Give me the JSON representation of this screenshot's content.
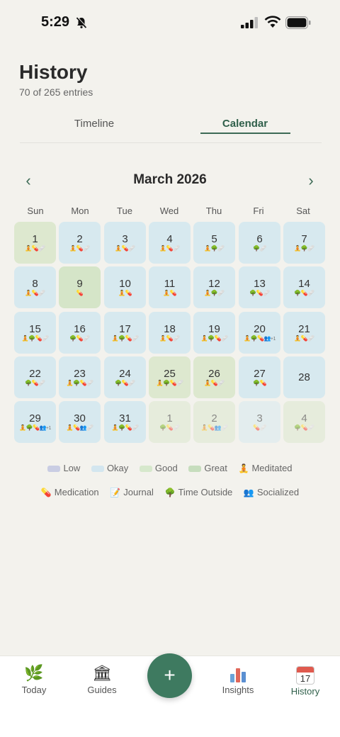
{
  "status_bar": {
    "time": "5:29",
    "icons": [
      "bell-slash-icon",
      "signal-icon",
      "wifi-icon",
      "battery-icon"
    ]
  },
  "header": {
    "title": "History",
    "subtitle": "70 of 265 entries"
  },
  "tabs": [
    {
      "label": "Timeline",
      "active": false
    },
    {
      "label": "Calendar",
      "active": true
    }
  ],
  "calendar": {
    "month_label": "March 2026",
    "prev_label": "‹",
    "next_label": "›",
    "weekdays": [
      "Sun",
      "Mon",
      "Tue",
      "Wed",
      "Thu",
      "Fri",
      "Sat"
    ],
    "days": [
      {
        "num": "1",
        "mood": "good",
        "emojis": "🧘💊🩹"
      },
      {
        "num": "2",
        "mood": "okay",
        "emojis": "🧘💊🩹"
      },
      {
        "num": "3",
        "mood": "okay",
        "emojis": "🧘💊🩹"
      },
      {
        "num": "4",
        "mood": "okay",
        "emojis": "🧘💊🩹"
      },
      {
        "num": "5",
        "mood": "okay",
        "emojis": "🧘🌳🩹"
      },
      {
        "num": "6",
        "mood": "okay",
        "emojis": "🌳🩹"
      },
      {
        "num": "7",
        "mood": "okay",
        "emojis": "🧘🌳🩹"
      },
      {
        "num": "8",
        "mood": "okay",
        "emojis": "🧘💊🩹"
      },
      {
        "num": "9",
        "mood": "great",
        "emojis": "💊"
      },
      {
        "num": "10",
        "mood": "okay",
        "emojis": "🧘💊"
      },
      {
        "num": "11",
        "mood": "okay",
        "emojis": "🧘💊"
      },
      {
        "num": "12",
        "mood": "okay",
        "emojis": "🧘🌳🩹"
      },
      {
        "num": "13",
        "mood": "okay",
        "emojis": "🌳💊🩹"
      },
      {
        "num": "14",
        "mood": "okay",
        "emojis": "🌳💊🩹"
      },
      {
        "num": "15",
        "mood": "okay",
        "emojis": "🧘🌳💊🩹"
      },
      {
        "num": "16",
        "mood": "okay",
        "emojis": "🌳💊🩹"
      },
      {
        "num": "17",
        "mood": "okay",
        "emojis": "🧘🌳💊🩹"
      },
      {
        "num": "18",
        "mood": "okay",
        "emojis": "🧘💊🩹"
      },
      {
        "num": "19",
        "mood": "okay",
        "emojis": "🧘🌳💊🩹"
      },
      {
        "num": "20",
        "mood": "okay",
        "emojis": "🧘🌳💊👥",
        "more": "+1"
      },
      {
        "num": "21",
        "mood": "okay",
        "emojis": "🧘💊🩹"
      },
      {
        "num": "22",
        "mood": "okay",
        "emojis": "🌳💊🩹"
      },
      {
        "num": "23",
        "mood": "okay",
        "emojis": "🧘🌳💊🩹"
      },
      {
        "num": "24",
        "mood": "okay",
        "emojis": "🌳💊🩹"
      },
      {
        "num": "25",
        "mood": "good",
        "emojis": "🧘🌳💊🩹"
      },
      {
        "num": "26",
        "mood": "good",
        "emojis": "🧘💊🩹"
      },
      {
        "num": "27",
        "mood": "okay",
        "emojis": "🌳💊"
      },
      {
        "num": "28",
        "mood": "okay",
        "emojis": ""
      },
      {
        "num": "29",
        "mood": "okay",
        "emojis": "🧘🌳💊👥",
        "more": "+1"
      },
      {
        "num": "30",
        "mood": "okay",
        "emojis": "🧘💊👥🩹"
      },
      {
        "num": "31",
        "mood": "okay",
        "emojis": "🧘🌳💊🩹"
      },
      {
        "num": "1",
        "mood": "good",
        "emojis": "🌳💊🩹",
        "outside": true
      },
      {
        "num": "2",
        "mood": "good",
        "emojis": "🧘💊👥🩹",
        "outside": true
      },
      {
        "num": "3",
        "mood": "okay",
        "emojis": "💊🩹",
        "outside": true
      },
      {
        "num": "4",
        "mood": "good",
        "emojis": "🌳💊🩹",
        "outside": true
      }
    ]
  },
  "legend": {
    "moods": [
      {
        "label": "Low",
        "color": "#c9cde3"
      },
      {
        "label": "Okay",
        "color": "#d3e6ef"
      },
      {
        "label": "Good",
        "color": "#d6e8cc"
      },
      {
        "label": "Great",
        "color": "#c6ddbd"
      }
    ],
    "activities": [
      {
        "emoji": "🧘",
        "label": "Meditated"
      },
      {
        "emoji": "💊",
        "label": "Medication"
      },
      {
        "emoji": "📝",
        "label": "Journal"
      },
      {
        "emoji": "🌳",
        "label": "Time Outside"
      },
      {
        "emoji": "👥",
        "label": "Socialized"
      }
    ]
  },
  "bottom_nav": {
    "items": [
      {
        "label": "Today",
        "icon": "🌿"
      },
      {
        "label": "Guides",
        "icon": "🏛"
      },
      {
        "label": "Insights",
        "icon": "bar-chart-icon"
      },
      {
        "label": "History",
        "icon": "calendar-icon",
        "calendar_day": "17",
        "active": true
      }
    ],
    "add_label": "+"
  },
  "colors": {
    "accent": "#3e7a60",
    "background": "#f3f2ed"
  }
}
